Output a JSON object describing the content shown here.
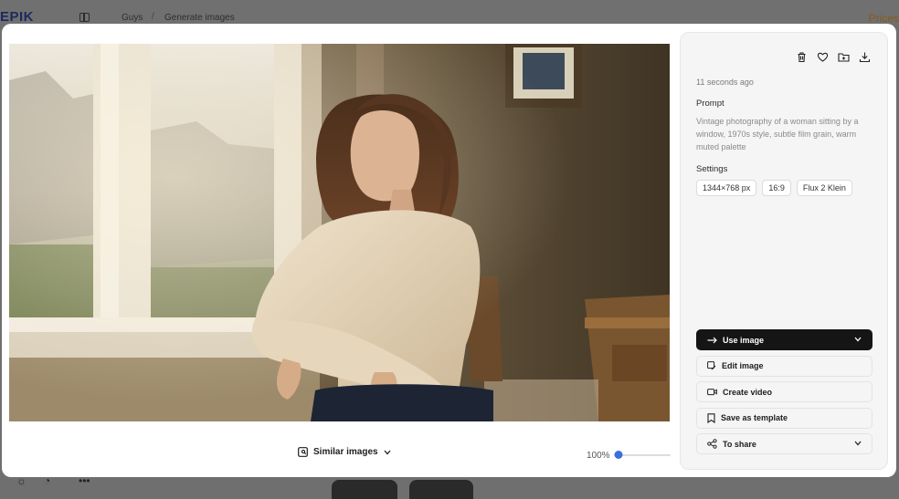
{
  "background": {
    "logo": "EPIK",
    "breadcrumb": [
      "Guys",
      "Generate images"
    ],
    "breadcrumb_separator": "/",
    "pricing": "Prices",
    "bottom_more": "•••"
  },
  "image": {
    "subject": "woman-by-window-photo"
  },
  "bottom_bar": {
    "similar_label": "Similar images",
    "zoom_label": "100%",
    "zoom_fraction": 0.0
  },
  "panel": {
    "timestamp": "11 seconds ago",
    "prompt_heading": "Prompt",
    "prompt_text": "Vintage photography of a woman sitting by a window, 1970s style, subtle film grain, warm muted palette",
    "settings_heading": "Settings",
    "settings_chips": [
      "1344×768 px",
      "16:9",
      "Flux 2 Klein"
    ],
    "icons": [
      "trash-icon",
      "heart-icon",
      "folder-add-icon",
      "download-icon"
    ],
    "actions": {
      "use_image": "Use image",
      "edit_image": "Edit image",
      "create_video": "Create video",
      "save_template": "Save as template",
      "share": "To share"
    }
  },
  "colors": {
    "accent": "#3a6fe0",
    "primary_button": "#151515"
  }
}
